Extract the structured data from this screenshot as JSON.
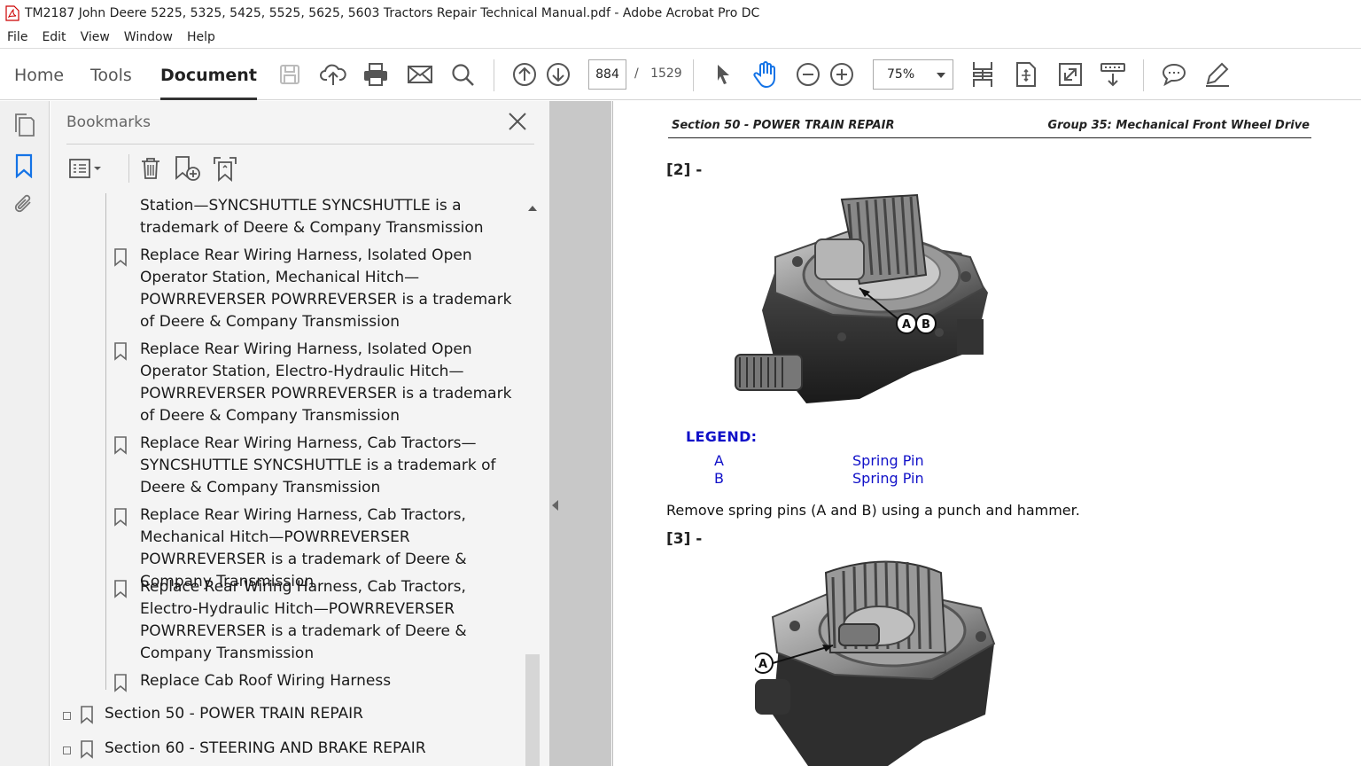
{
  "window": {
    "title": "TM2187 John Deere 5225, 5325, 5425, 5525, 5625, 5603 Tractors Repair Technical Manual.pdf - Adobe Acrobat Pro DC"
  },
  "menu": [
    "File",
    "Edit",
    "View",
    "Window",
    "Help"
  ],
  "toolbar": {
    "tabs": [
      "Home",
      "Tools",
      "Document"
    ],
    "active_tab": "Document",
    "page_current": "884",
    "page_separator": "/",
    "page_total": "1529",
    "zoom": "75%"
  },
  "bookmarks": {
    "title": "Bookmarks",
    "items": [
      {
        "text": "Station—SYNCSHUTTLE SYNCSHUTTLE is a trademark of Deere & Company Transmission"
      },
      {
        "text": "Replace Rear Wiring Harness, Isolated Open Operator Station, Mechanical Hitch—POWRREVERSER POWRREVERSER is a trademark of Deere & Company Transmission"
      },
      {
        "text": "Replace Rear Wiring Harness, Isolated Open Operator Station, Electro-Hydraulic Hitch—POWRREVERSER POWRREVERSER is a trademark of Deere & Company Transmission"
      },
      {
        "text": "Replace Rear Wiring Harness, Cab Tractors—SYNCSHUTTLE SYNCSHUTTLE is a trademark of Deere & Company Transmission"
      },
      {
        "text": "Replace Rear Wiring Harness, Cab Tractors, Mechanical Hitch—POWRREVERSER POWRREVERSER is a trademark of Deere & Company Transmission"
      },
      {
        "text": "Replace Rear Wiring Harness, Cab Tractors, Electro-Hydraulic Hitch—POWRREVERSER POWRREVERSER is a trademark of Deere & Company Transmission"
      },
      {
        "text": "Replace Cab Roof Wiring Harness"
      }
    ],
    "sections": [
      {
        "text": "Section 50 - POWER TRAIN REPAIR"
      },
      {
        "text": "Section 60 - STEERING AND BRAKE REPAIR"
      }
    ]
  },
  "document": {
    "header_left": "Section 50 - POWER TRAIN REPAIR",
    "header_right": "Group 35: Mechanical Front Wheel Drive",
    "step2": "[2] -",
    "step3": "[3] -",
    "legend_title": "LEGEND:",
    "legend": [
      {
        "key": "A",
        "desc": "Spring Pin"
      },
      {
        "key": "B",
        "desc": "Spring Pin"
      }
    ],
    "instruction": "Remove spring pins (A and B) using a punch and hammer.",
    "callouts_fig1": [
      "A",
      "B"
    ],
    "callouts_fig2": [
      "A"
    ]
  },
  "colors": {
    "legend_blue": "#1010c8",
    "panel_bg": "#f4f4f4",
    "gray_area": "#c8c8c8"
  }
}
